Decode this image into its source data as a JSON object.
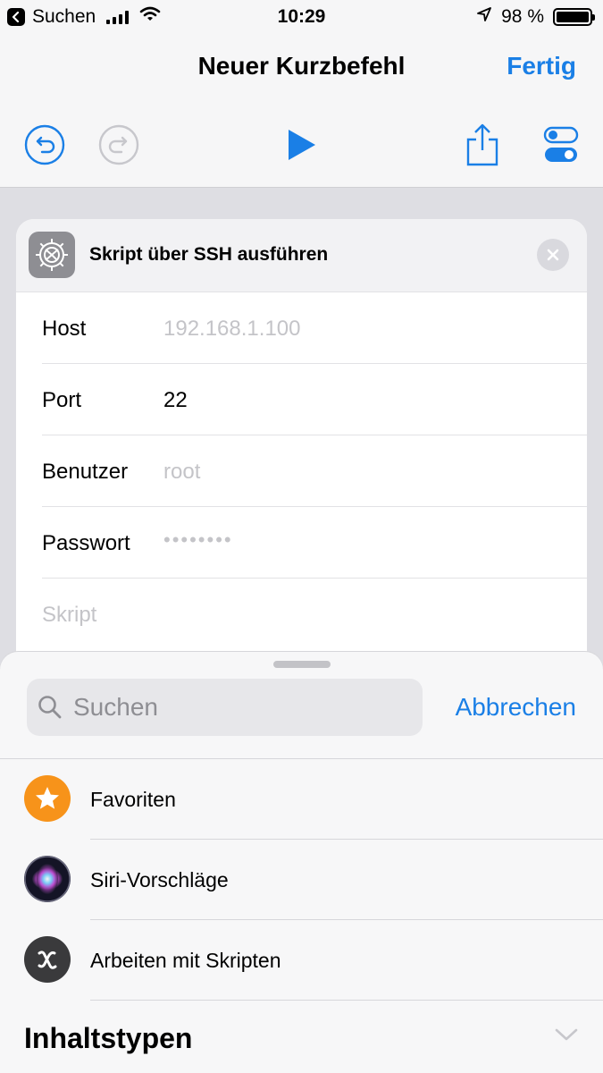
{
  "status_bar": {
    "back_app": "Suchen",
    "time": "10:29",
    "battery": "98 %"
  },
  "nav": {
    "title": "Neuer Kurzbefehl",
    "done_label": "Fertig"
  },
  "action": {
    "title": "Skript über SSH ausführen",
    "fields": [
      {
        "label": "Host",
        "value": "192.168.1.100",
        "is_placeholder": true
      },
      {
        "label": "Port",
        "value": "22",
        "is_placeholder": false
      },
      {
        "label": "Benutzer",
        "value": "root",
        "is_placeholder": true
      },
      {
        "label": "Passwort",
        "value": "••••••••",
        "is_placeholder": true
      }
    ],
    "script_placeholder": "Skript"
  },
  "sheet": {
    "search_placeholder": "Suchen",
    "cancel_label": "Abbrechen",
    "items": [
      {
        "label": "Favoriten",
        "icon": "star-icon"
      },
      {
        "label": "Siri-Vorschläge",
        "icon": "siri-icon"
      },
      {
        "label": "Arbeiten mit Skripten",
        "icon": "scripting-icon"
      }
    ],
    "section_title": "Inhaltstypen"
  },
  "colors": {
    "accent": "#1a7fe6",
    "favorites": "#f7931a",
    "scripting": "#3a3a3c",
    "action_icon": "#8e8e93"
  }
}
